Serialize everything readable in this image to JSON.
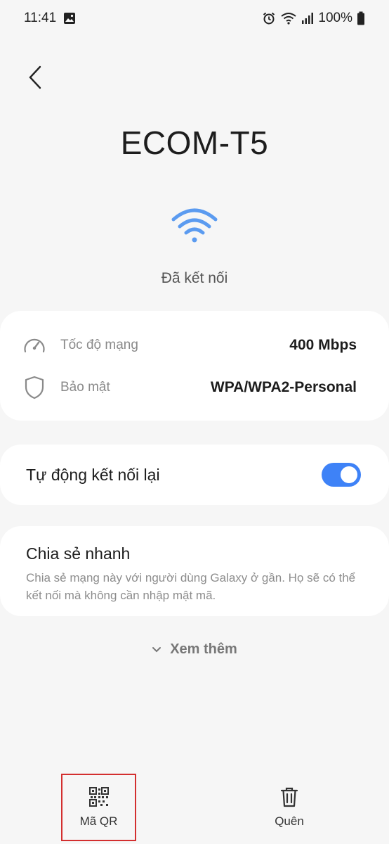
{
  "status_bar": {
    "time": "11:41",
    "battery": "100%",
    "icons": [
      "gallery-icon",
      "alarm-icon",
      "wifi-icon",
      "signal-icon",
      "battery-icon"
    ]
  },
  "header": {
    "back_icon": "chevron-left-icon",
    "network_name": "ECOM-T5",
    "connection_status": "Đã kết nối"
  },
  "info": {
    "speed_label": "Tốc độ mạng",
    "speed_value": "400 Mbps",
    "security_label": "Bảo mật",
    "security_value": "WPA/WPA2-Personal"
  },
  "auto_reconnect": {
    "label": "Tự động kết nối lại",
    "enabled": true
  },
  "quick_share": {
    "title": "Chia sẻ nhanh",
    "description": "Chia sẻ mạng này với người dùng Galaxy ở gần. Họ sẽ có thể kết nối mà không cần nhập mật mã."
  },
  "see_more": {
    "label": "Xem thêm"
  },
  "bottom_bar": {
    "qr_label": "Mã QR",
    "forget_label": "Quên"
  },
  "colors": {
    "accent": "#3e82f7",
    "wifi": "#5b9bf0",
    "highlight": "#d32f2f",
    "background": "#f6f6f6"
  }
}
